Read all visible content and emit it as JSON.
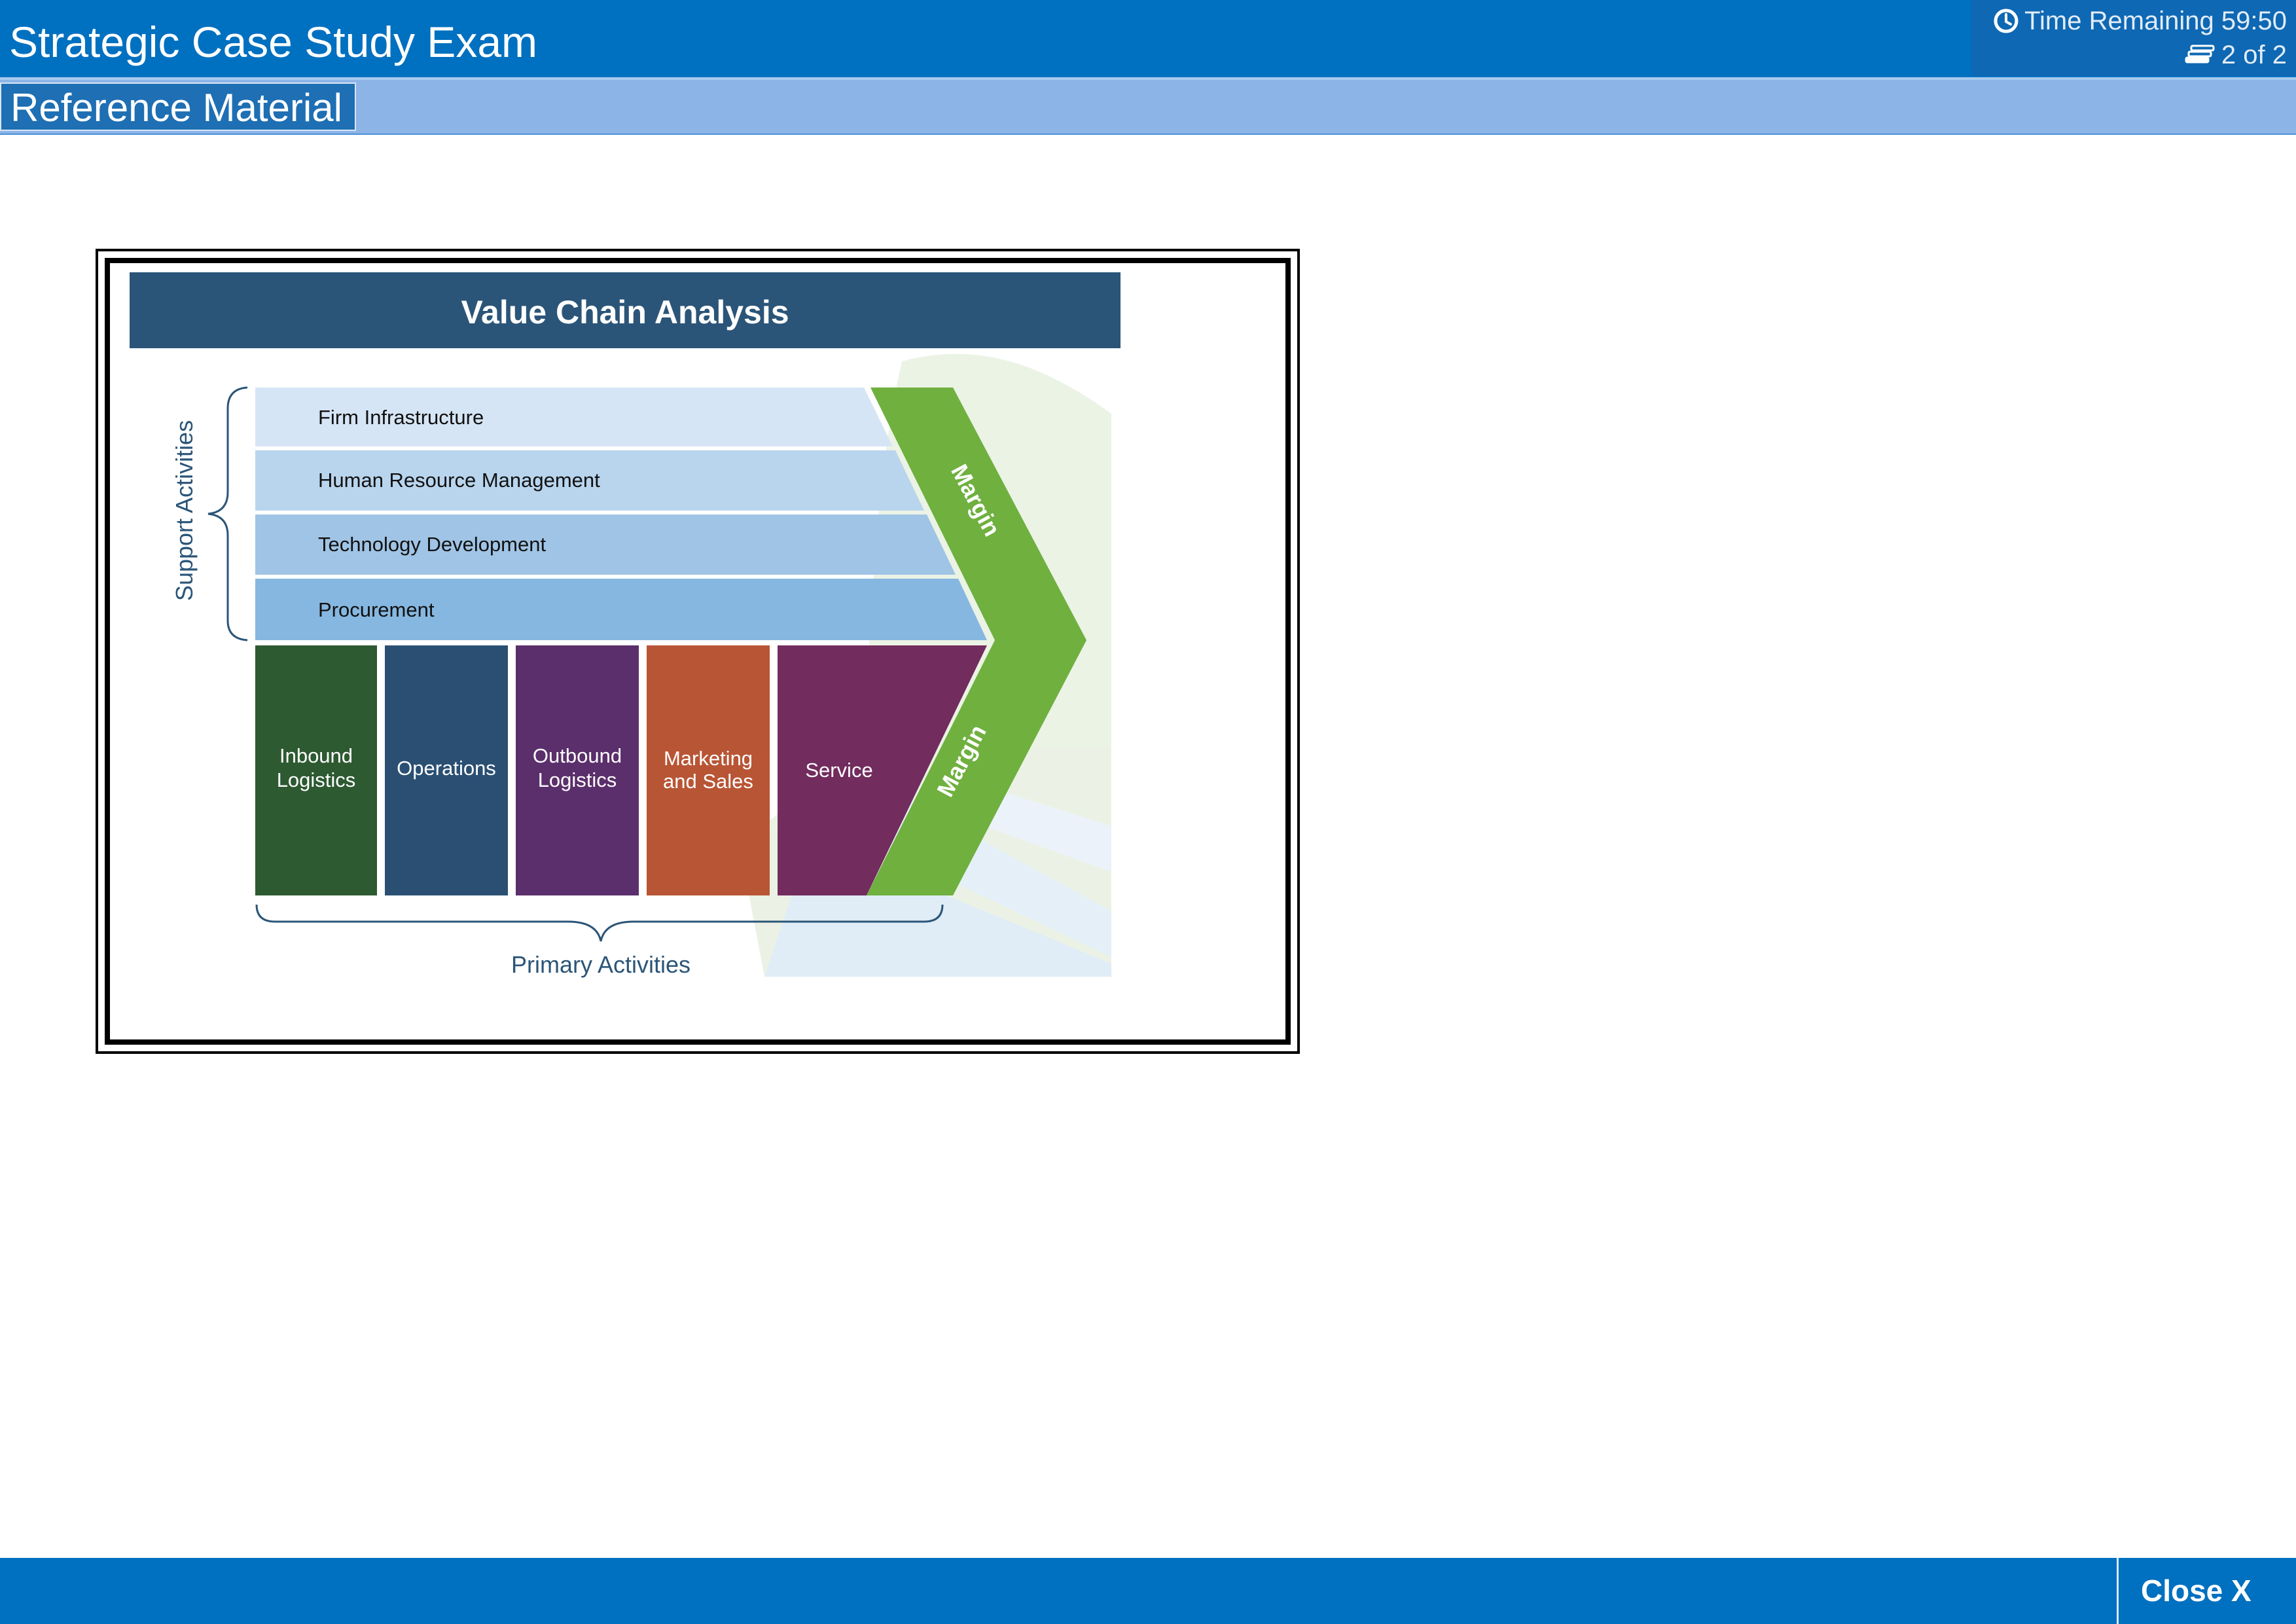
{
  "header": {
    "title": "Strategic Case Study Exam",
    "time_remaining": "Time Remaining 59:50",
    "page_counter": "2 of 2",
    "time_icon": "clock-icon",
    "page_icon": "stack-icon"
  },
  "subheader": {
    "tab_label": "Reference Material"
  },
  "figure": {
    "title": "Value Chain Analysis",
    "support_label": "Support Activities",
    "primary_label": "Primary Activities",
    "support_activities": [
      "Firm Infrastructure",
      "Human Resource Management",
      "Technology Development",
      "Procurement"
    ],
    "primary_activities": [
      {
        "line1": "Inbound",
        "line2": "Logistics"
      },
      {
        "line1": "Operations",
        "line2": ""
      },
      {
        "line1": "Outbound",
        "line2": "Logistics"
      },
      {
        "line1": "Marketing",
        "line2": "and Sales"
      },
      {
        "line1": "Service",
        "line2": ""
      }
    ],
    "margin_upper": "Margin",
    "margin_lower": "Margin",
    "colors": {
      "title_bar": "#2b5578",
      "margin": "#6fb03f",
      "primary": [
        "#2d5a31",
        "#2a4f73",
        "#5b2f6b",
        "#b85535",
        "#722c5e"
      ],
      "support": [
        "#d6e5f5",
        "#b9d5ee",
        "#a0c4e5",
        "#86b7e0"
      ]
    }
  },
  "footer": {
    "close_label": "Close X"
  }
}
